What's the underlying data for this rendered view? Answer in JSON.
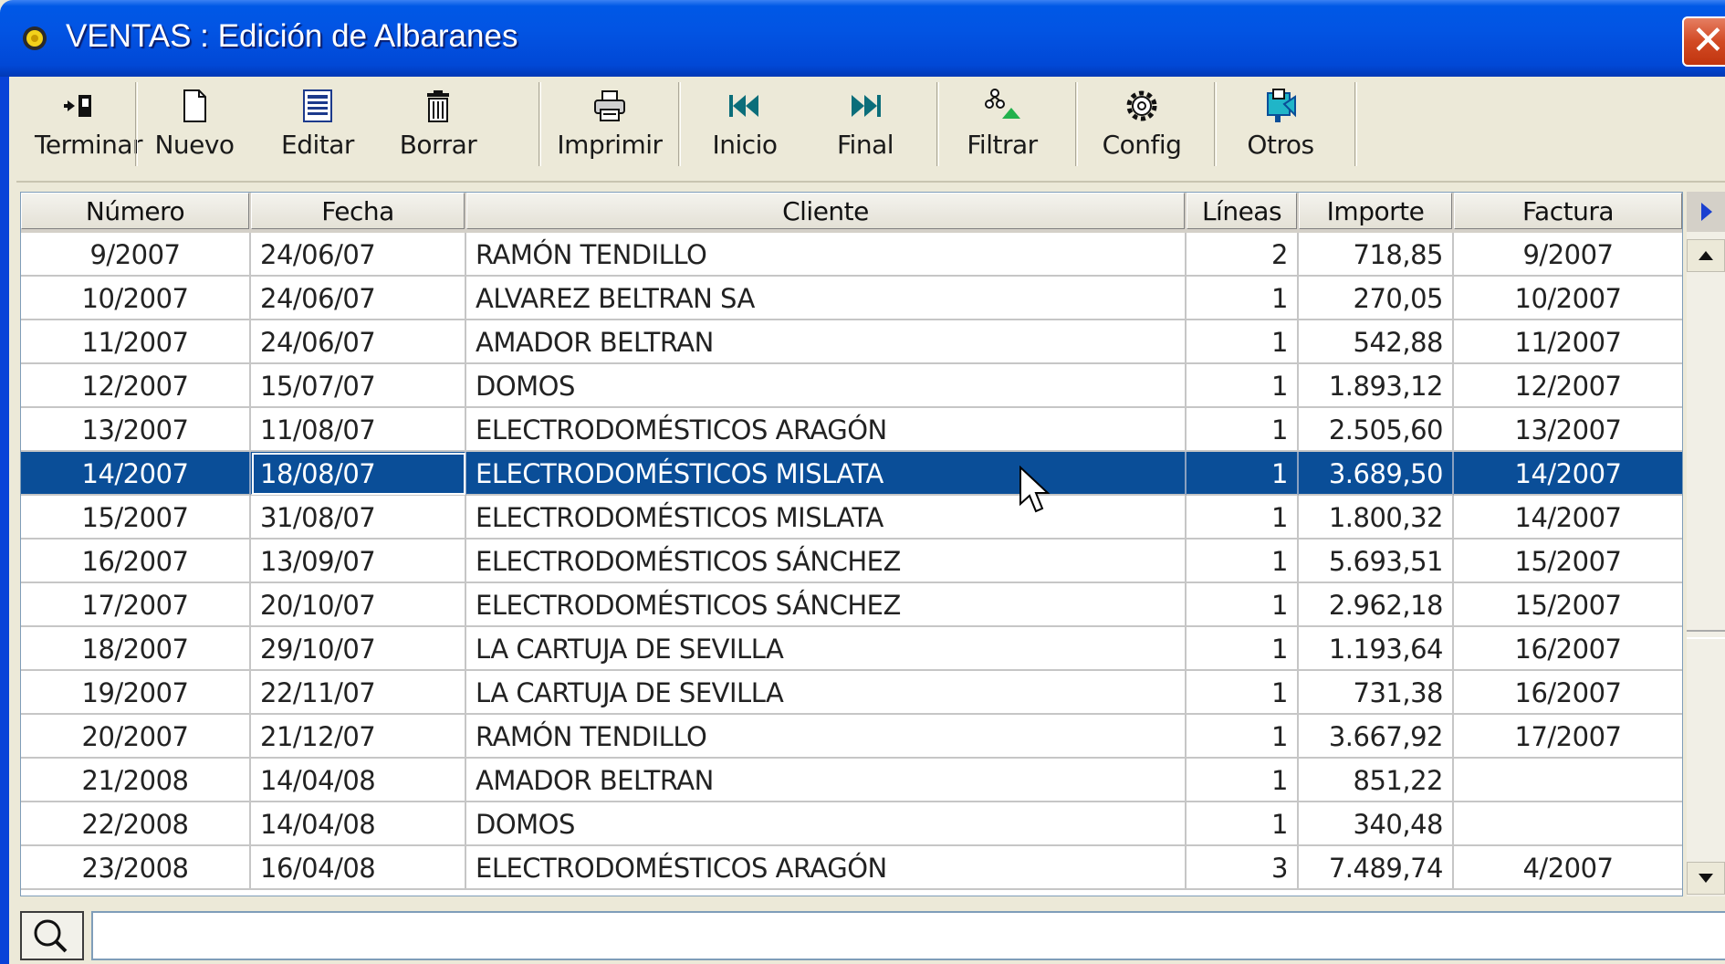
{
  "window": {
    "title": "VENTAS : Edición de Albaranes",
    "close_symbol": "✕"
  },
  "toolbar": {
    "buttons": [
      {
        "label": "Terminar",
        "icon": "exit-icon"
      },
      {
        "label": "Nuevo",
        "icon": "new-document-icon"
      },
      {
        "label": "Editar",
        "icon": "edit-form-icon"
      },
      {
        "label": "Borrar",
        "icon": "trash-icon"
      },
      {
        "label": "Imprimir",
        "icon": "printer-icon"
      },
      {
        "label": "Inicio",
        "icon": "first-record-icon"
      },
      {
        "label": "Final",
        "icon": "last-record-icon"
      },
      {
        "label": "Filtrar",
        "icon": "filter-icon"
      },
      {
        "label": "Config",
        "icon": "gear-icon"
      },
      {
        "label": "Otros",
        "icon": "others-icon"
      }
    ]
  },
  "table": {
    "columns": [
      "Número",
      "Fecha",
      "Cliente",
      "Líneas",
      "Importe",
      "Factura"
    ],
    "selected_row": 5,
    "rows": [
      [
        "9/2007",
        "24/06/07",
        "RAMÓN TENDILLO",
        "2",
        "718,85",
        "9/2007"
      ],
      [
        "10/2007",
        "24/06/07",
        "ALVAREZ BELTRAN SA",
        "1",
        "270,05",
        "10/2007"
      ],
      [
        "11/2007",
        "24/06/07",
        "AMADOR BELTRAN",
        "1",
        "542,88",
        "11/2007"
      ],
      [
        "12/2007",
        "15/07/07",
        "DOMOS",
        "1",
        "1.893,12",
        "12/2007"
      ],
      [
        "13/2007",
        "11/08/07",
        "ELECTRODOMÉSTICOS ARAGÓN",
        "1",
        "2.505,60",
        "13/2007"
      ],
      [
        "14/2007",
        "18/08/07",
        "ELECTRODOMÉSTICOS MISLATA",
        "1",
        "3.689,50",
        "14/2007"
      ],
      [
        "15/2007",
        "31/08/07",
        "ELECTRODOMÉSTICOS MISLATA",
        "1",
        "1.800,32",
        "14/2007"
      ],
      [
        "16/2007",
        "13/09/07",
        "ELECTRODOMÉSTICOS SÁNCHEZ",
        "1",
        "5.693,51",
        "15/2007"
      ],
      [
        "17/2007",
        "20/10/07",
        "ELECTRODOMÉSTICOS SÁNCHEZ",
        "1",
        "2.962,18",
        "15/2007"
      ],
      [
        "18/2007",
        "29/10/07",
        "LA CARTUJA DE SEVILLA",
        "1",
        "1.193,64",
        "16/2007"
      ],
      [
        "19/2007",
        "22/11/07",
        "LA CARTUJA DE SEVILLA",
        "1",
        "731,38",
        "16/2007"
      ],
      [
        "20/2007",
        "21/12/07",
        "RAMÓN TENDILLO",
        "1",
        "3.667,92",
        "17/2007"
      ],
      [
        "21/2008",
        "14/04/08",
        "AMADOR BELTRAN",
        "1",
        "851,22",
        ""
      ],
      [
        "22/2008",
        "14/04/08",
        "DOMOS",
        "1",
        "340,48",
        ""
      ],
      [
        "23/2008",
        "16/04/08",
        "ELECTRODOMÉSTICOS ARAGÓN",
        "3",
        "7.489,74",
        "4/2007"
      ]
    ]
  },
  "search": {
    "value": "",
    "placeholder": ""
  },
  "colors": {
    "title_bar": "#0254e3",
    "selection": "#0a4e98",
    "close_button": "#d24a24"
  }
}
